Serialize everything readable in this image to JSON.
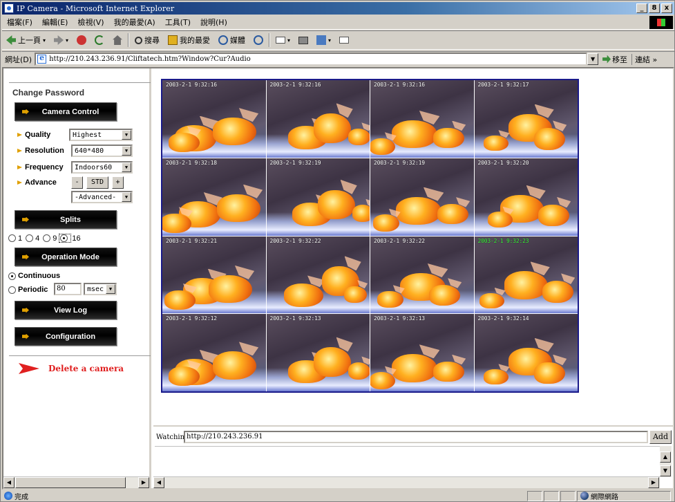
{
  "window": {
    "title": "IP Camera - Microsoft Internet Explorer",
    "controls": [
      "_",
      "8",
      "x"
    ]
  },
  "menubar": [
    "檔案(F)",
    "編輯(E)",
    "檢視(V)",
    "我的最愛(A)",
    "工具(T)",
    "說明(H)"
  ],
  "toolbar": {
    "back_label": "上一頁",
    "search_label": "搜尋",
    "favorites_label": "我的最愛",
    "history_label": "媒體"
  },
  "addressbar": {
    "label": "網址(D)",
    "url": "http://210.243.236.91/Cliftatech.htm?Window?Cur?Audio",
    "go_label": "移至",
    "links_label": "連結 »"
  },
  "panel": {
    "change_password": "Change Password",
    "camera_control": "Camera Control",
    "quality_label": "Quality",
    "quality_value": "Highest",
    "resolution_label": "Resolution",
    "resolution_value": "640*480",
    "frequency_label": "Frequency",
    "frequency_value": "Indoors60",
    "advance_label": "Advance",
    "advance_minus": "-",
    "advance_std": "STD",
    "advance_plus": "+",
    "advance_value": "-Advanced-",
    "splits": "Splits",
    "split_options": [
      "1",
      "4",
      "9",
      "16"
    ],
    "split_selected": "16",
    "operation_mode": "Operation Mode",
    "continuous": "Continuous",
    "periodic": "Periodic",
    "periodic_value": "80",
    "periodic_unit": "msec",
    "view_log": "View Log",
    "configuration": "Configuration",
    "delete_camera": "Delete a camera"
  },
  "camera_grid": {
    "timestamps": [
      "2003-2-1 9:32:16",
      "2003-2-1 9:32:16",
      "2003-2-1 9:32:16",
      "2003-2-1 9:32:17",
      "2003-2-1 9:32:18",
      "2003-2-1 9:32:19",
      "2003-2-1 9:32:19",
      "2003-2-1 9:32:20",
      "2003-2-1 9:32:21",
      "2003-2-1 9:32:22",
      "2003-2-1 9:32:22",
      "2003-2-1 9:32:23",
      "2003-2-1 9:32:12",
      "2003-2-1 9:32:13",
      "2003-2-1 9:32:13",
      "2003-2-1 9:32:14"
    ],
    "highlight_color": "#40ff40",
    "border_color": "#1a1a8a"
  },
  "watching": {
    "label": "Watching",
    "value": "http://210.243.236.91",
    "add_label": "Add"
  },
  "statusbar": {
    "left_text": "完成",
    "zone_text": "網際網路"
  }
}
